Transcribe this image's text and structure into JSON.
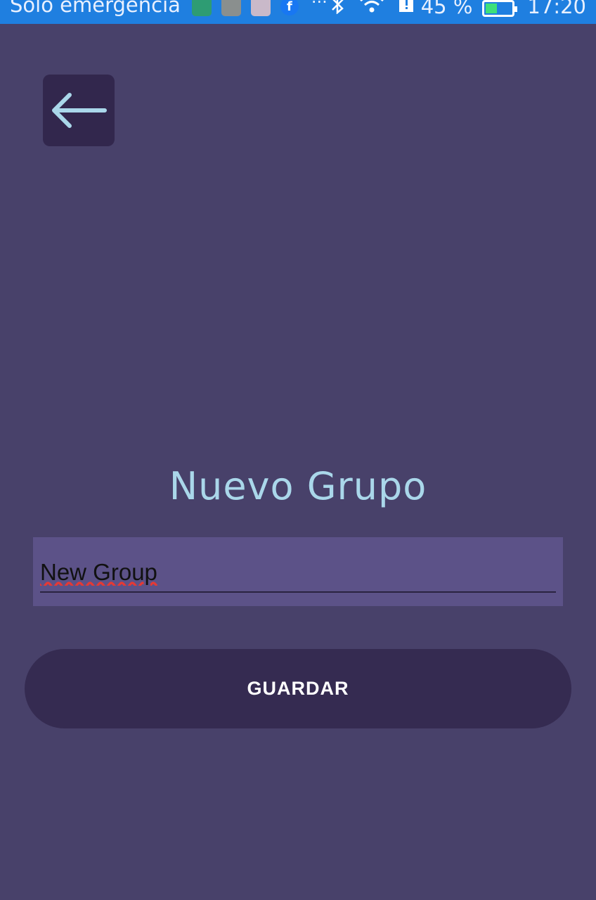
{
  "status_bar": {
    "carrier_text": "Solo emergencia",
    "notification_icons": [
      "game-icon",
      "activity-icon",
      "cat-icon",
      "facebook-icon"
    ],
    "more_text": "···",
    "battery_percent": "45 %",
    "battery_level": 0.45,
    "time": "17:20",
    "color": "#1f7fe0"
  },
  "header": {
    "back_icon": "arrow-left-icon"
  },
  "main": {
    "title": "Nuevo Grupo",
    "group_name_value": "New Group",
    "save_label": "GUARDAR"
  },
  "colors": {
    "background": "#48416a",
    "title": "#aad7ea",
    "field_background": "#5c5288",
    "button_background": "#352b51",
    "back_button_background": "#32274d"
  }
}
